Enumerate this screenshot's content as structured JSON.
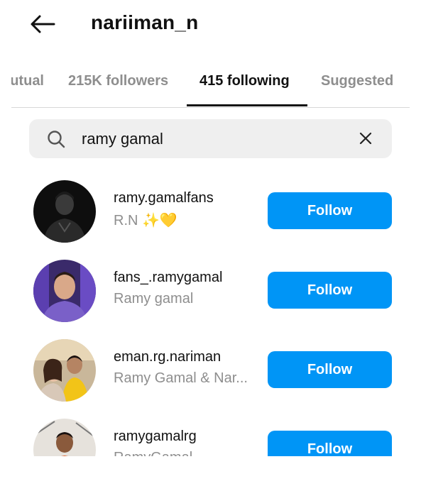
{
  "header": {
    "title": "nariiman_n",
    "back_icon": "arrow-left-icon"
  },
  "tabs": [
    {
      "label": "utual",
      "active": false
    },
    {
      "label": "215K followers",
      "active": false
    },
    {
      "label": "415 following",
      "active": true
    },
    {
      "label": "Suggested",
      "active": false
    }
  ],
  "search": {
    "value": "ramy gamal",
    "icon": "search-icon",
    "clear_icon": "close-icon"
  },
  "users": [
    {
      "username": "ramy.gamalfans",
      "fullname": "R.N ✨💛",
      "button": "Follow"
    },
    {
      "username": "fans_.ramygamal",
      "fullname": "Ramy gamal",
      "button": "Follow"
    },
    {
      "username": "eman.rg.nariman",
      "fullname": "Ramy Gamal & Nar...",
      "button": "Follow"
    },
    {
      "username": "ramygamalrg",
      "fullname": "RamyGamal",
      "button": "Follow"
    }
  ],
  "colors": {
    "accent": "#0095f6",
    "muted": "#8e8e8e",
    "search_bg": "#efefef"
  }
}
